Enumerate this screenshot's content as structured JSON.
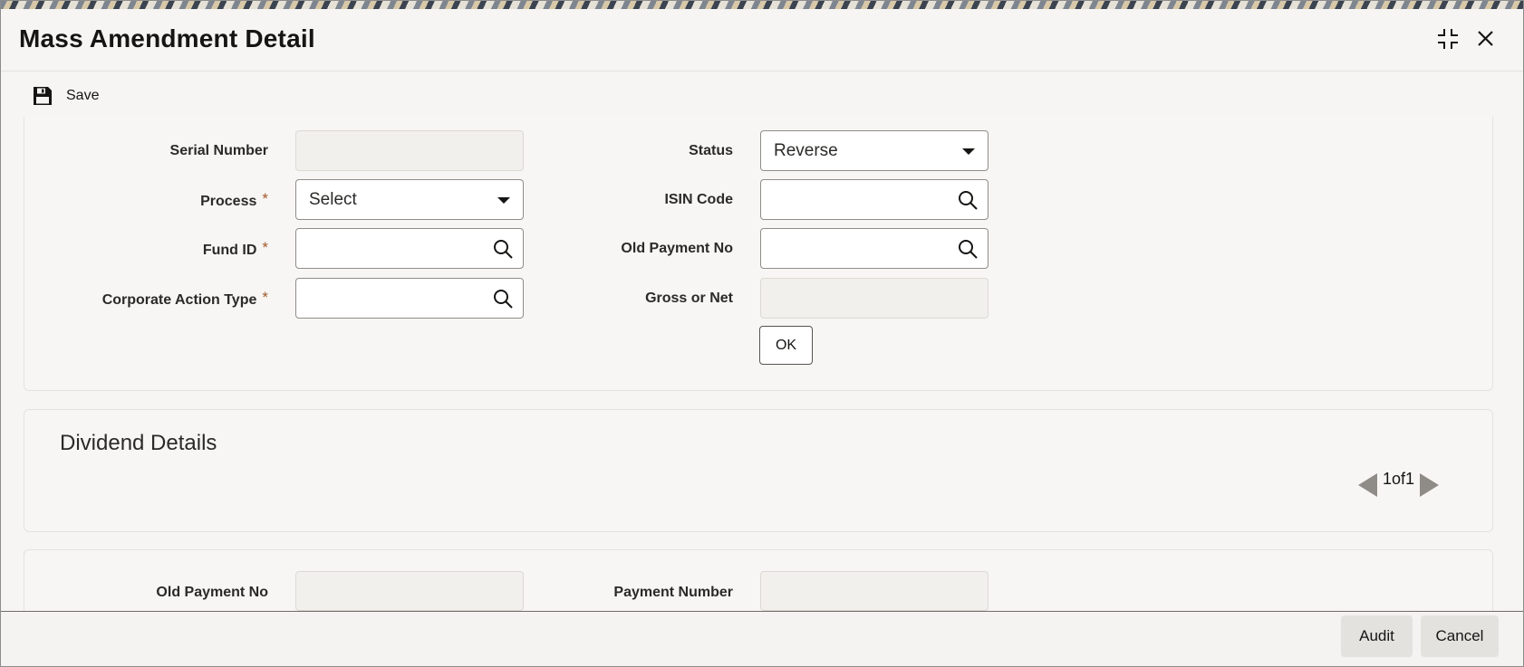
{
  "window": {
    "title": "Mass Amendment Detail"
  },
  "toolbar": {
    "save_label": "Save"
  },
  "form": {
    "serial_number": {
      "label": "Serial Number",
      "value": ""
    },
    "process": {
      "label": "Process",
      "value": "Select",
      "required_mark": "*"
    },
    "fund_id": {
      "label": "Fund ID",
      "value": "",
      "required_mark": "*"
    },
    "corporate_action_type": {
      "label": "Corporate Action Type",
      "value": "",
      "required_mark": "*"
    },
    "status": {
      "label": "Status",
      "value": "Reverse"
    },
    "isin_code": {
      "label": "ISIN Code",
      "value": ""
    },
    "old_payment_no": {
      "label": "Old Payment No",
      "value": ""
    },
    "gross_or_net": {
      "label": "Gross or Net",
      "value": ""
    },
    "ok_label": "OK"
  },
  "dividend_details": {
    "title": "Dividend Details",
    "pager": "1of1",
    "old_payment_no": {
      "label": "Old Payment No",
      "value": ""
    },
    "payment_number": {
      "label": "Payment Number",
      "value": ""
    }
  },
  "footer": {
    "audit_label": "Audit",
    "cancel_label": "Cancel"
  },
  "icons": {
    "save": "floppy-disk-icon",
    "search": "search-icon",
    "dropdown": "caret-down-icon",
    "maximize": "maximize-icon",
    "close": "close-icon"
  }
}
